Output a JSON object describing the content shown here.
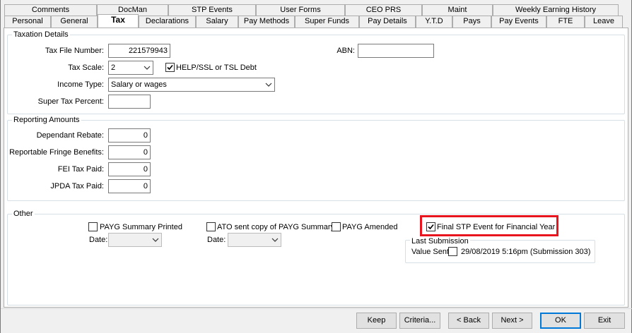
{
  "tabs_row1": [
    {
      "label": "Comments"
    },
    {
      "label": "DocMan"
    },
    {
      "label": "STP Events"
    },
    {
      "label": "User Forms"
    },
    {
      "label": "CEO PRS"
    },
    {
      "label": "Maint"
    },
    {
      "label": "Weekly Earning History"
    }
  ],
  "tabs_row2": [
    {
      "label": "Personal"
    },
    {
      "label": "General"
    },
    {
      "label": "Tax"
    },
    {
      "label": "Declarations"
    },
    {
      "label": "Salary"
    },
    {
      "label": "Pay Methods"
    },
    {
      "label": "Super Funds"
    },
    {
      "label": "Pay Details"
    },
    {
      "label": "Y.T.D"
    },
    {
      "label": "Pays"
    },
    {
      "label": "Pay Events"
    },
    {
      "label": "FTE"
    },
    {
      "label": "Leave"
    }
  ],
  "taxation": {
    "title": "Taxation Details",
    "tfn_label": "Tax File Number:",
    "tfn_value": "221579943",
    "abn_label": "ABN:",
    "abn_value": "",
    "scale_label": "Tax Scale:",
    "scale_value": "2",
    "help_label": "HELP/SSL or TSL Debt",
    "help_checked": true,
    "income_label": "Income Type:",
    "income_value": "Salary or wages",
    "super_label": "Super Tax Percent:",
    "super_value": ""
  },
  "reporting": {
    "title": "Reporting Amounts",
    "dependant_label": "Dependant Rebate:",
    "dependant_value": "0",
    "fringe_label": "Reportable Fringe Benefits:",
    "fringe_value": "0",
    "fei_label": "FEI Tax Paid:",
    "fei_value": "0",
    "jpda_label": "JPDA Tax Paid:",
    "jpda_value": "0"
  },
  "other": {
    "title": "Other",
    "payg_printed_label": "PAYG Summary Printed",
    "payg_printed_checked": false,
    "ato_label": "ATO sent copy of PAYG Summary",
    "ato_checked": false,
    "payg_amended_label": "PAYG Amended",
    "payg_amended_checked": false,
    "final_stp_label": "Final STP Event for Financial Year",
    "final_stp_checked": true,
    "date_label_1": "Date:",
    "date_label_2": "Date:",
    "last_submission_title": "Last Submission",
    "value_sent_label": "Value Sent:",
    "value_sent_checked": false,
    "value_sent_text": "29/08/2019 5:16pm (Submission 303)"
  },
  "buttons": {
    "keep": "Keep",
    "criteria": "Criteria...",
    "back": "< Back",
    "next": "Next >",
    "ok": "OK",
    "exit": "Exit"
  },
  "highlight_color": "#e8141e",
  "accent_color": "#0078d7"
}
